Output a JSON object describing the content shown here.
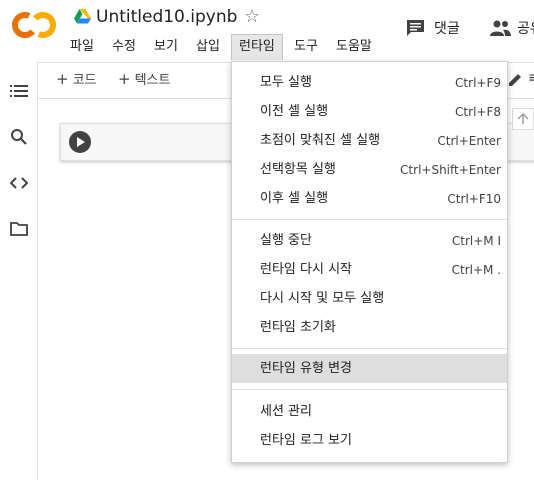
{
  "header": {
    "title": "Untitled10.ipynb",
    "comment_label": "댓글",
    "share_label": "공유"
  },
  "menubar": {
    "items": [
      "파일",
      "수정",
      "보기",
      "삽입",
      "런타임",
      "도구",
      "도움말"
    ],
    "active": "런타임"
  },
  "toolbar": {
    "add_code": "코드",
    "add_text": "텍스트",
    "plus": "+"
  },
  "dropdown": {
    "groups": [
      [
        {
          "label": "모두 실행",
          "shortcut": "Ctrl+F9"
        },
        {
          "label": "이전 셀 실행",
          "shortcut": "Ctrl+F8"
        },
        {
          "label": "초점이 맞춰진 셀 실행",
          "shortcut": "Ctrl+Enter"
        },
        {
          "label": "선택항목 실행",
          "shortcut": "Ctrl+Shift+Enter"
        },
        {
          "label": "이후 셀 실행",
          "shortcut": "Ctrl+F10"
        }
      ],
      [
        {
          "label": "실행 중단",
          "shortcut": "Ctrl+M I"
        },
        {
          "label": "런타임 다시 시작",
          "shortcut": "Ctrl+M ."
        },
        {
          "label": "다시 시작 및 모두 실행",
          "shortcut": ""
        },
        {
          "label": "런타임 초기화",
          "shortcut": ""
        }
      ],
      [
        {
          "label": "런타임 유형 변경",
          "shortcut": "",
          "highlighted": true
        }
      ],
      [
        {
          "label": "세션 관리",
          "shortcut": ""
        },
        {
          "label": "런타임 로그 보기",
          "shortcut": ""
        }
      ]
    ]
  },
  "icons": {
    "logo": "colab-logo",
    "drive": "google-drive-icon",
    "star": "star-icon",
    "comment": "comment-icon",
    "share": "share-people-icon",
    "rail": [
      "toc-icon",
      "search-icon",
      "code-snippets-icon",
      "folder-icon"
    ],
    "run": "play-icon",
    "pencil": "pencil-icon"
  },
  "colors": {
    "logo_orange": "#F9AB00",
    "logo_dark_orange": "#E8710A",
    "highlight": "#DEDEDE"
  }
}
